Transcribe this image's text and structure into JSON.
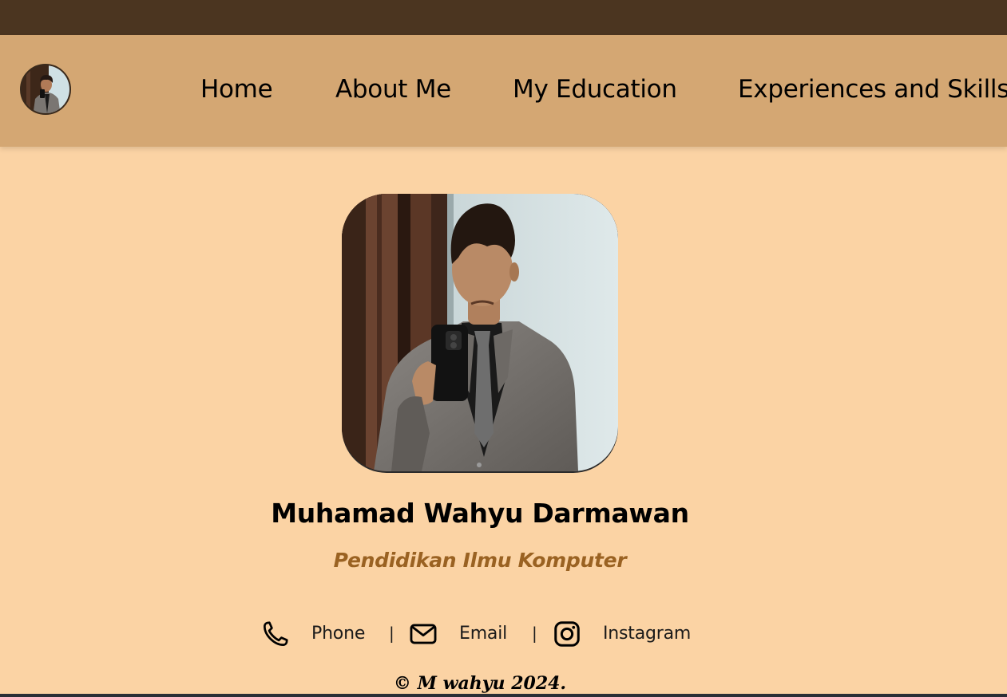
{
  "nav": {
    "links": [
      {
        "label": "Home"
      },
      {
        "label": "About Me"
      },
      {
        "label": "My Education"
      },
      {
        "label": "Experiences and Skills"
      }
    ]
  },
  "profile": {
    "name": "Muhamad Wahyu Darmawan",
    "subtitle": "Pendidikan Ilmu Komputer"
  },
  "contacts": {
    "phone": {
      "label": "Phone",
      "icon": "phone-icon"
    },
    "email": {
      "label": "Email",
      "icon": "mail-icon"
    },
    "instagram": {
      "label": "Instagram",
      "icon": "instagram-icon"
    },
    "separator": "|"
  },
  "footer": {
    "text": "© M wahyu 2024."
  },
  "colors": {
    "topbar": "#4b3520",
    "nav": "#d4a773",
    "background": "#fbd3a4",
    "subtitle": "#9a6222"
  }
}
